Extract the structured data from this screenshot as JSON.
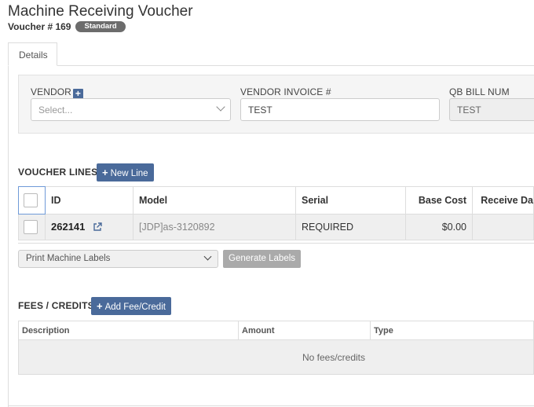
{
  "header": {
    "title": "Machine Receiving Voucher",
    "voucher_label": "Voucher # 169",
    "badge": "Standard"
  },
  "tabs": [
    {
      "label": "Details",
      "active": true
    }
  ],
  "vendor_section": {
    "vendor_label": "VENDOR",
    "vendor_add_icon": "+",
    "vendor_placeholder": "Select...",
    "invoice_label": "VENDOR INVOICE #",
    "invoice_value": "TEST",
    "qb_label": "QB BILL NUM",
    "qb_value": "TEST"
  },
  "voucher_lines": {
    "title": "VOUCHER LINES",
    "new_line_button": "New Line",
    "columns": [
      "ID",
      "Model",
      "Serial",
      "Base Cost",
      "Receive Da"
    ],
    "rows": [
      {
        "id": "262141",
        "model": "[JDP]as-3120892",
        "serial": "REQUIRED",
        "base_cost": "$0.00",
        "receive_date": ""
      }
    ],
    "print_select_value": "Print Machine Labels",
    "generate_button": "Generate Labels"
  },
  "fees": {
    "title": "FEES / CREDITS",
    "add_button": "Add Fee/Credit",
    "columns": [
      "Description",
      "Amount",
      "Type"
    ],
    "empty_text": "No fees/credits"
  },
  "colors": {
    "primary_button": "#4a6a9a",
    "disabled_button": "#aaaaaa",
    "badge": "#6c6c6c"
  }
}
